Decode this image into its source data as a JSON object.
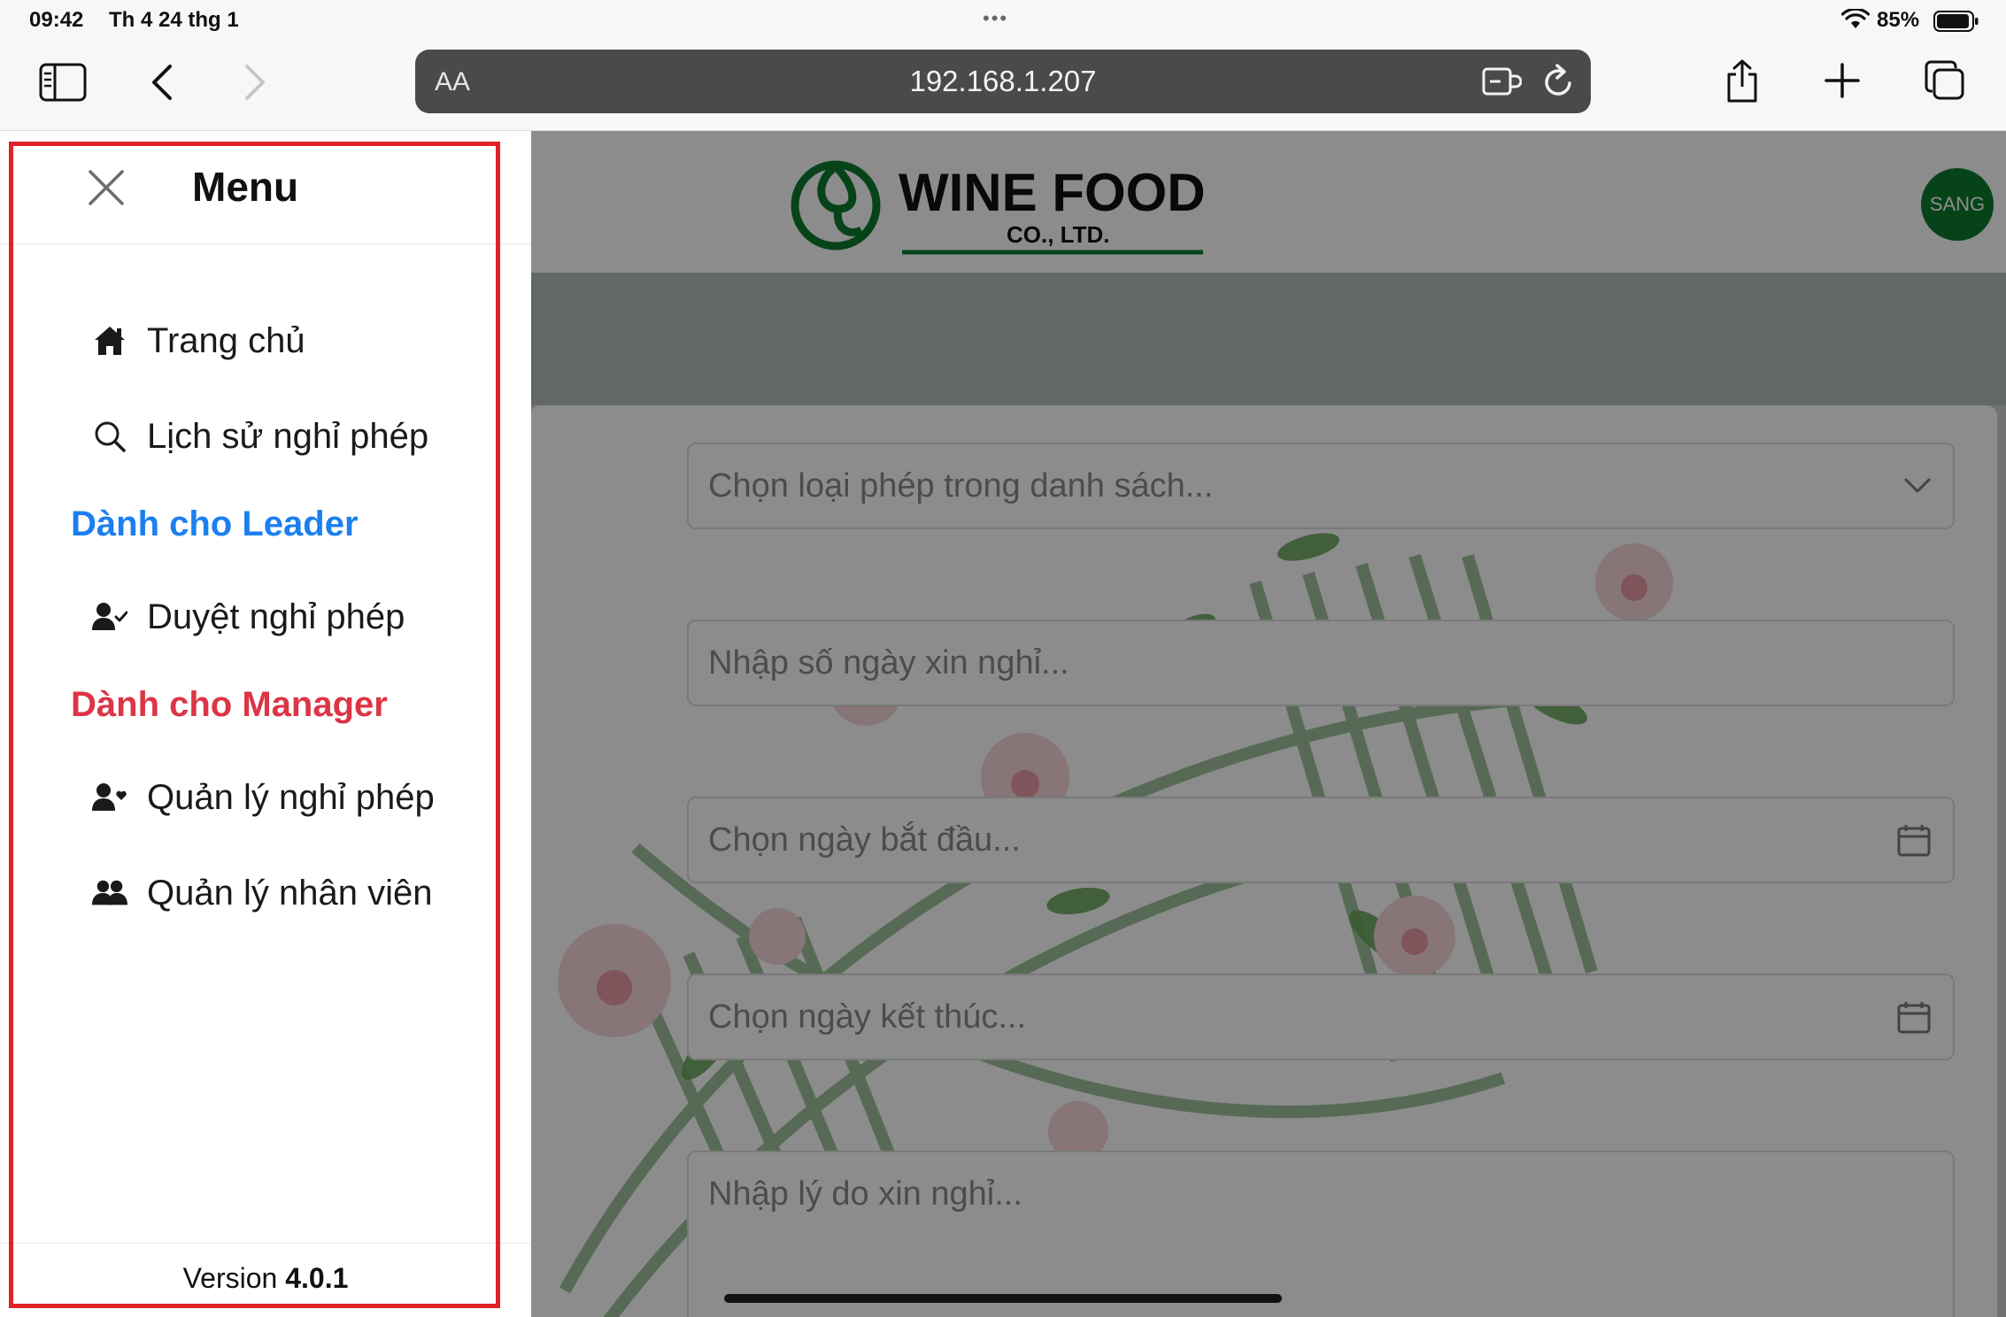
{
  "status_bar": {
    "time": "09:42",
    "date": "Th 4 24 thg 1",
    "battery_percent": "85%",
    "battery_level": 0.85
  },
  "browser": {
    "text_size_label": "AA",
    "url": "192.168.1.207"
  },
  "app": {
    "logo_text": "WINE FOOD",
    "logo_subtext": "CO., LTD.",
    "user_avatar_label": "SANG",
    "brand_color": "#0d7a2f"
  },
  "form": {
    "leave_type_placeholder": "Chọn loại phép trong danh sách...",
    "days_placeholder": "Nhập số ngày xin nghỉ...",
    "start_date_placeholder": "Chọn ngày bắt đầu...",
    "end_date_placeholder": "Chọn ngày kết thúc...",
    "reason_placeholder": "Nhập lý do xin nghỉ..."
  },
  "menu": {
    "title": "Menu",
    "items": [
      {
        "label": "Trang chủ",
        "icon": "home-icon"
      },
      {
        "label": "Lịch sử nghỉ phép",
        "icon": "search-icon"
      }
    ],
    "leader_section": {
      "title": "Dành cho Leader",
      "color": "#1b7ff0",
      "items": [
        {
          "label": "Duyệt nghỉ phép",
          "icon": "user-check-icon"
        }
      ]
    },
    "manager_section": {
      "title": "Dành cho Manager",
      "color": "#dc3545",
      "items": [
        {
          "label": "Quản lý nghỉ phép",
          "icon": "user-heart-icon"
        },
        {
          "label": "Quản lý nhân viên",
          "icon": "users-icon"
        }
      ]
    },
    "version_label": "Version",
    "version_number": "4.0.1",
    "highlight_color": "#e02229"
  }
}
